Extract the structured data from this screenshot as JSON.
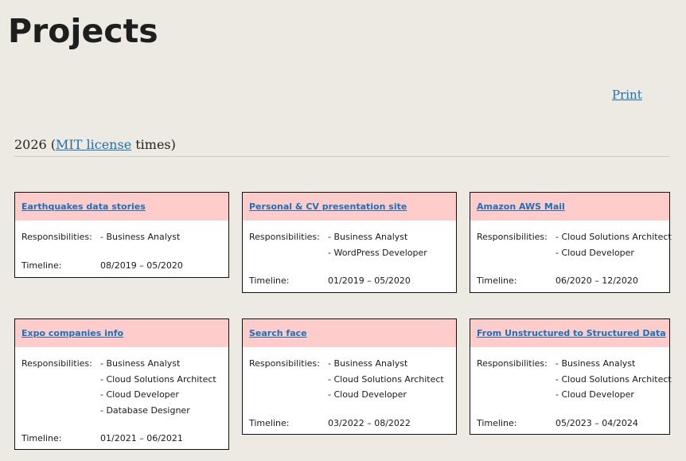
{
  "page": {
    "title": "Projects",
    "print_label": "Print"
  },
  "section": {
    "year": "2026 (",
    "license_link": "MIT license",
    "suffix": " times)"
  },
  "labels": {
    "responsibilities": "Responsibilities:",
    "timeline": "Timeline:"
  },
  "projects": [
    {
      "title": "Earthquakes data stories",
      "responsibilities": [
        "- Business Analyst"
      ],
      "timeline": "08/2019 – 05/2020"
    },
    {
      "title": "Personal & CV presentation site",
      "responsibilities": [
        "- Business Analyst",
        "- WordPress Developer"
      ],
      "timeline": "01/2019 – 05/2020"
    },
    {
      "title": "Amazon AWS Mail",
      "responsibilities": [
        "- Cloud Solutions Architect",
        "- Cloud Developer"
      ],
      "timeline": "06/2020 – 12/2020"
    },
    {
      "title": "Expo companies info",
      "responsibilities": [
        "- Business Analyst",
        "- Cloud Solutions Architect",
        "- Cloud Developer",
        "- Database Designer"
      ],
      "timeline": "01/2021 – 06/2021"
    },
    {
      "title": "Search face",
      "responsibilities": [
        "- Business Analyst",
        "- Cloud Solutions Architect",
        "- Cloud Developer"
      ],
      "timeline": "03/2022 – 08/2022"
    },
    {
      "title": "From Unstructured to Structured Data",
      "responsibilities": [
        "- Business Analyst",
        "- Cloud Solutions Architect",
        "- Cloud Developer"
      ],
      "timeline": "05/2023 – 04/2024"
    }
  ]
}
